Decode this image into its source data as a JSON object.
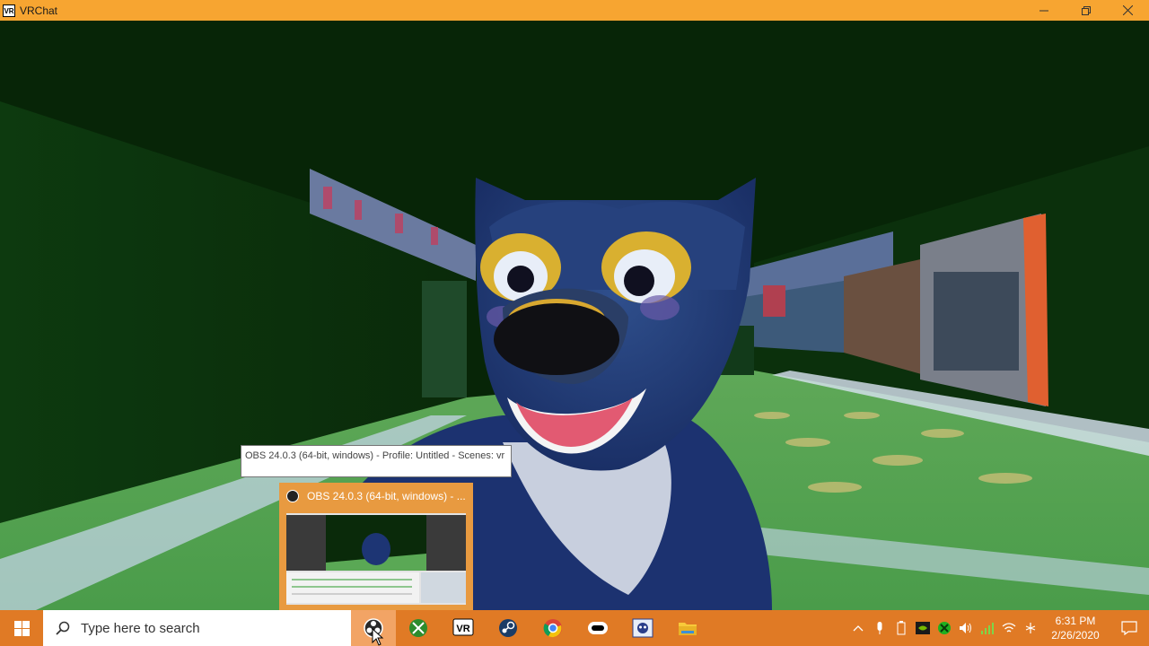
{
  "window": {
    "app_icon_text": "VR",
    "title": "VRChat"
  },
  "tooltip": {
    "text": "OBS 24.0.3 (64-bit, windows) - Profile: Untitled - Scenes: vr"
  },
  "thumbnail": {
    "title": "OBS 24.0.3 (64-bit, windows) - ..."
  },
  "taskbar": {
    "search_placeholder": "Type here to search",
    "apps": [
      {
        "name": "obs-studio-icon"
      },
      {
        "name": "xbox-icon"
      },
      {
        "name": "vrchat-icon",
        "text": "VR"
      },
      {
        "name": "steam-icon"
      },
      {
        "name": "chrome-icon"
      },
      {
        "name": "oculus-icon"
      },
      {
        "name": "discord-style-icon"
      },
      {
        "name": "file-explorer-icon"
      }
    ],
    "clock": {
      "time": "6:31 PM",
      "date": "2/26/2020"
    }
  },
  "colors": {
    "titlebar": "#f7a531",
    "taskbar": "#e07a25",
    "taskbar_active": "#f2a465"
  }
}
